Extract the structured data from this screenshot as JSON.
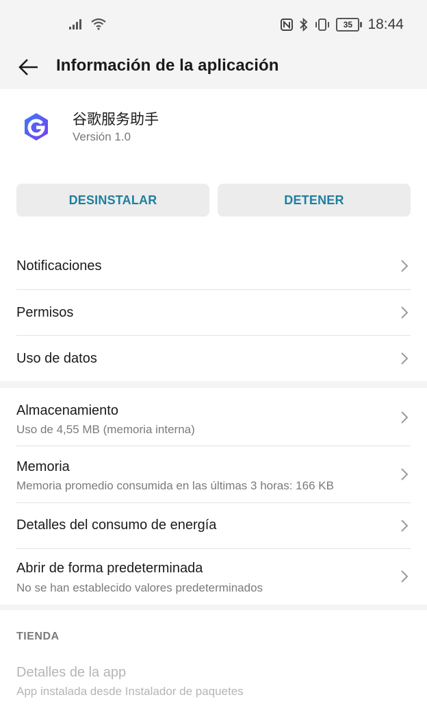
{
  "status_bar": {
    "time": "18:44",
    "battery": "35",
    "icons": [
      "signal-icon",
      "wifi-icon",
      "nfc-icon",
      "bluetooth-icon",
      "vibrate-icon",
      "battery-icon"
    ]
  },
  "app_bar": {
    "title": "Información de la aplicación",
    "back_icon": "back-arrow-icon"
  },
  "app": {
    "name": "谷歌服务助手",
    "version": "Versión 1.0",
    "icon": "app-g-icon",
    "icon_colors": [
      "#3b7cf5",
      "#7b3cf0"
    ]
  },
  "buttons": {
    "uninstall": "DESINSTALAR",
    "stop": "DETENER",
    "color": "#1e7fa0"
  },
  "section1": [
    {
      "title": "Notificaciones"
    },
    {
      "title": "Permisos"
    },
    {
      "title": "Uso de datos"
    }
  ],
  "section2": [
    {
      "title": "Almacenamiento",
      "subtitle": "Uso de 4,55 MB (memoria interna)"
    },
    {
      "title": "Memoria",
      "subtitle": "Memoria promedio consumida en las últimas 3 horas: 166 KB"
    },
    {
      "title": "Detalles del consumo de energía"
    },
    {
      "title": "Abrir de forma predeterminada",
      "subtitle": "No se han establecido valores predeterminados"
    }
  ],
  "store": {
    "category": "TIENDA",
    "item_title": "Detalles de la app",
    "item_subtitle": "App instalada desde Instalador de paquetes"
  }
}
